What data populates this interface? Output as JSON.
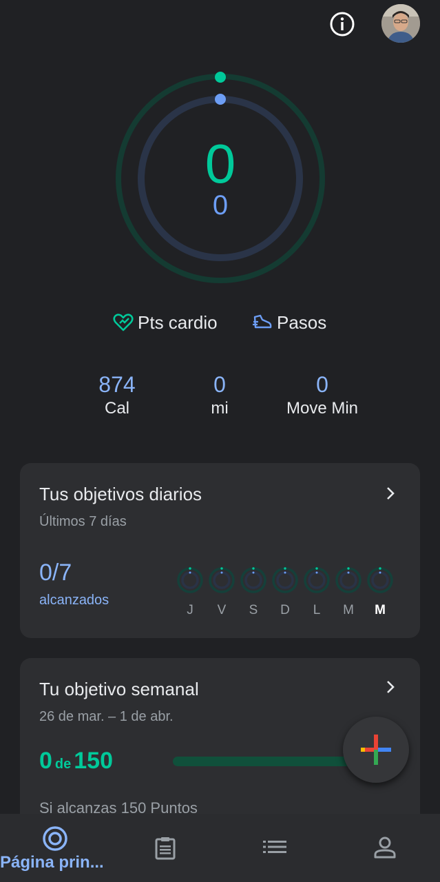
{
  "header": {
    "info_icon": "info-icon",
    "avatar": "profile-avatar"
  },
  "rings": {
    "cardio_points": "0",
    "steps": "0",
    "colors": {
      "cardio": "#00c99a",
      "steps": "#6d9ef5"
    }
  },
  "legend": {
    "cardio_label": "Pts cardio",
    "steps_label": "Pasos"
  },
  "stats": [
    {
      "value": "874",
      "label": "Cal"
    },
    {
      "value": "0",
      "label": "mi"
    },
    {
      "value": "0",
      "label": "Move Min"
    }
  ],
  "daily_goals": {
    "title": "Tus objetivos diarios",
    "subtitle": "Últimos 7 días",
    "achieved": "0/7",
    "achieved_label": "alcanzados",
    "days": [
      "J",
      "V",
      "S",
      "D",
      "L",
      "M",
      "M"
    ]
  },
  "weekly_goal": {
    "title": "Tu objetivo semanal",
    "subtitle": "26 de mar. – 1 de abr.",
    "current": "0",
    "of_label": "de",
    "target": "150",
    "description": "Si alcanzas 150 Puntos"
  },
  "fab": {
    "icon": "plus-icon"
  },
  "nav": {
    "home_label": "Página prin...",
    "items": [
      "home-icon",
      "journal-icon",
      "browse-icon",
      "profile-icon"
    ]
  }
}
